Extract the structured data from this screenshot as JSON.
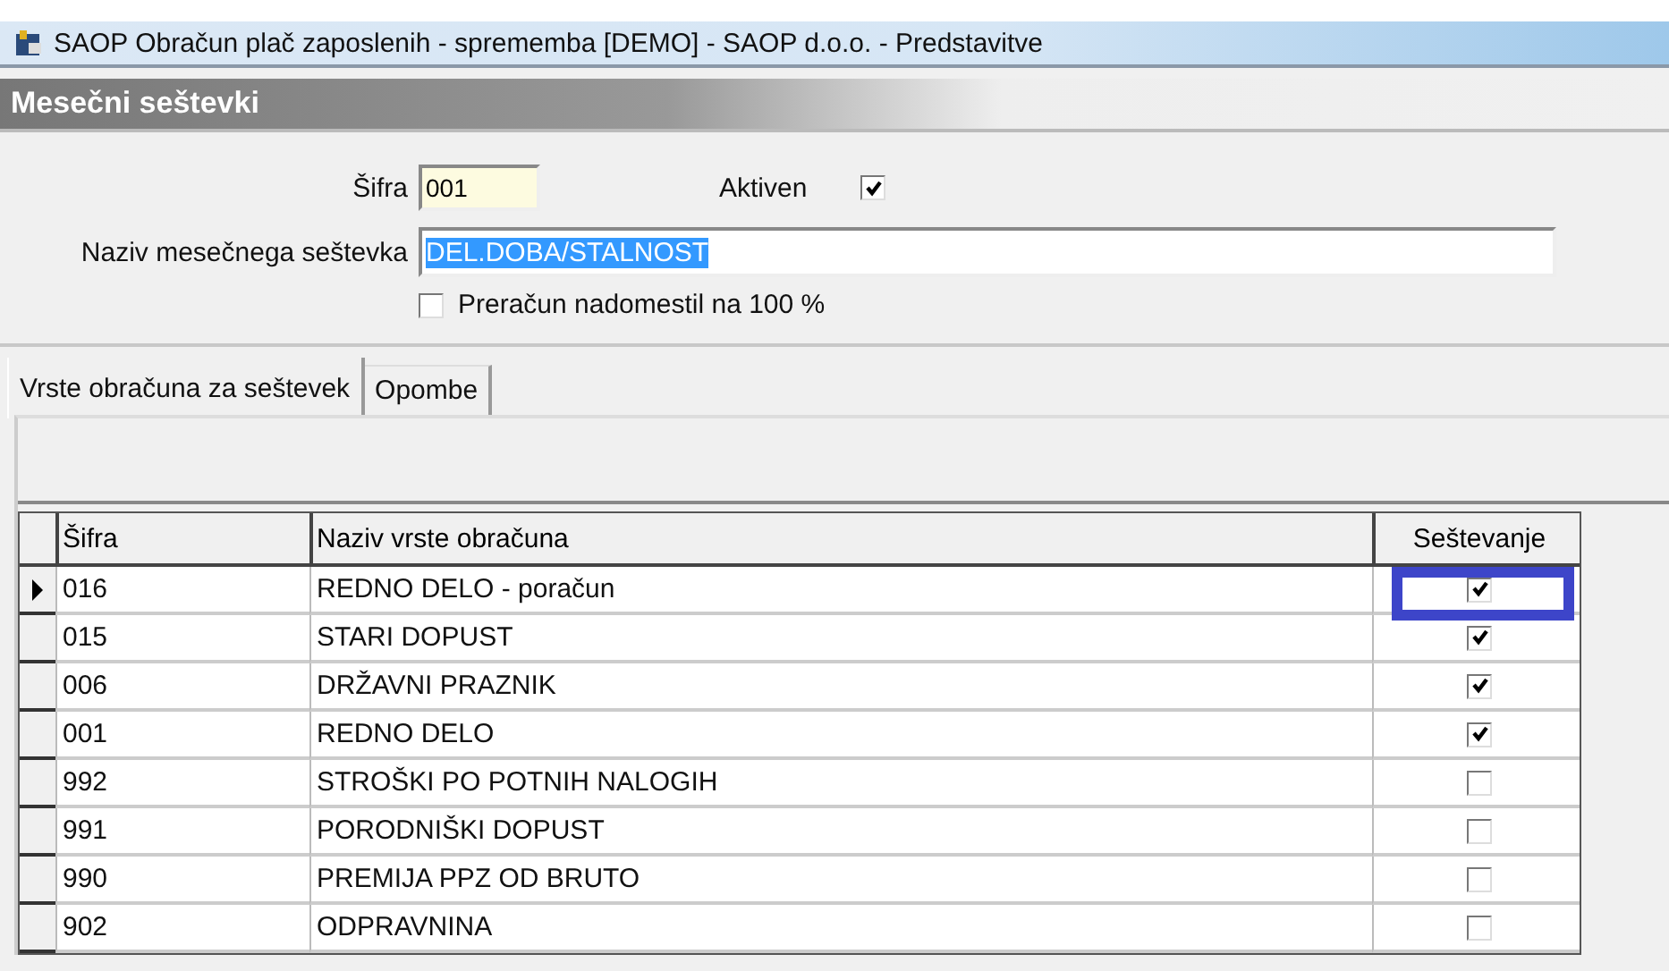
{
  "window": {
    "title": "SAOP Obračun plač zaposlenih - sprememba [DEMO] - SAOP d.o.o. - Predstavitve"
  },
  "panel": {
    "title": "Mesečni seštevki"
  },
  "form": {
    "code_label": "Šifra",
    "code_value": "001",
    "active_label": "Aktiven",
    "active_checked": true,
    "name_label": "Naziv mesečnega seštevka",
    "name_value": "DEL.DOBA/STALNOST",
    "recalc_label": "Preračun nadomestil na 100 %",
    "recalc_checked": false
  },
  "tabs": [
    {
      "label": "Vrste obračuna za seštevek",
      "selected": true
    },
    {
      "label": "Opombe",
      "selected": false
    }
  ],
  "table": {
    "columns": [
      "Šifra",
      "Naziv vrste obračuna",
      "Seštevanje"
    ],
    "rows": [
      {
        "code": "016",
        "name": "REDNO DELO - poračun",
        "checked": true,
        "selected": true
      },
      {
        "code": "015",
        "name": "STARI DOPUST",
        "checked": true,
        "selected": false
      },
      {
        "code": "006",
        "name": "DRŽAVNI PRAZNIK",
        "checked": true,
        "selected": false
      },
      {
        "code": "001",
        "name": "REDNO DELO",
        "checked": true,
        "selected": false
      },
      {
        "code": "992",
        "name": "STROŠKI PO POTNIH NALOGIH",
        "checked": false,
        "selected": false
      },
      {
        "code": "991",
        "name": "PORODNIŠKI DOPUST",
        "checked": false,
        "selected": false
      },
      {
        "code": "990",
        "name": "PREMIJA PPZ OD BRUTO",
        "checked": false,
        "selected": false
      },
      {
        "code": "902",
        "name": "ODPRAVNINA",
        "checked": false,
        "selected": false
      }
    ]
  }
}
